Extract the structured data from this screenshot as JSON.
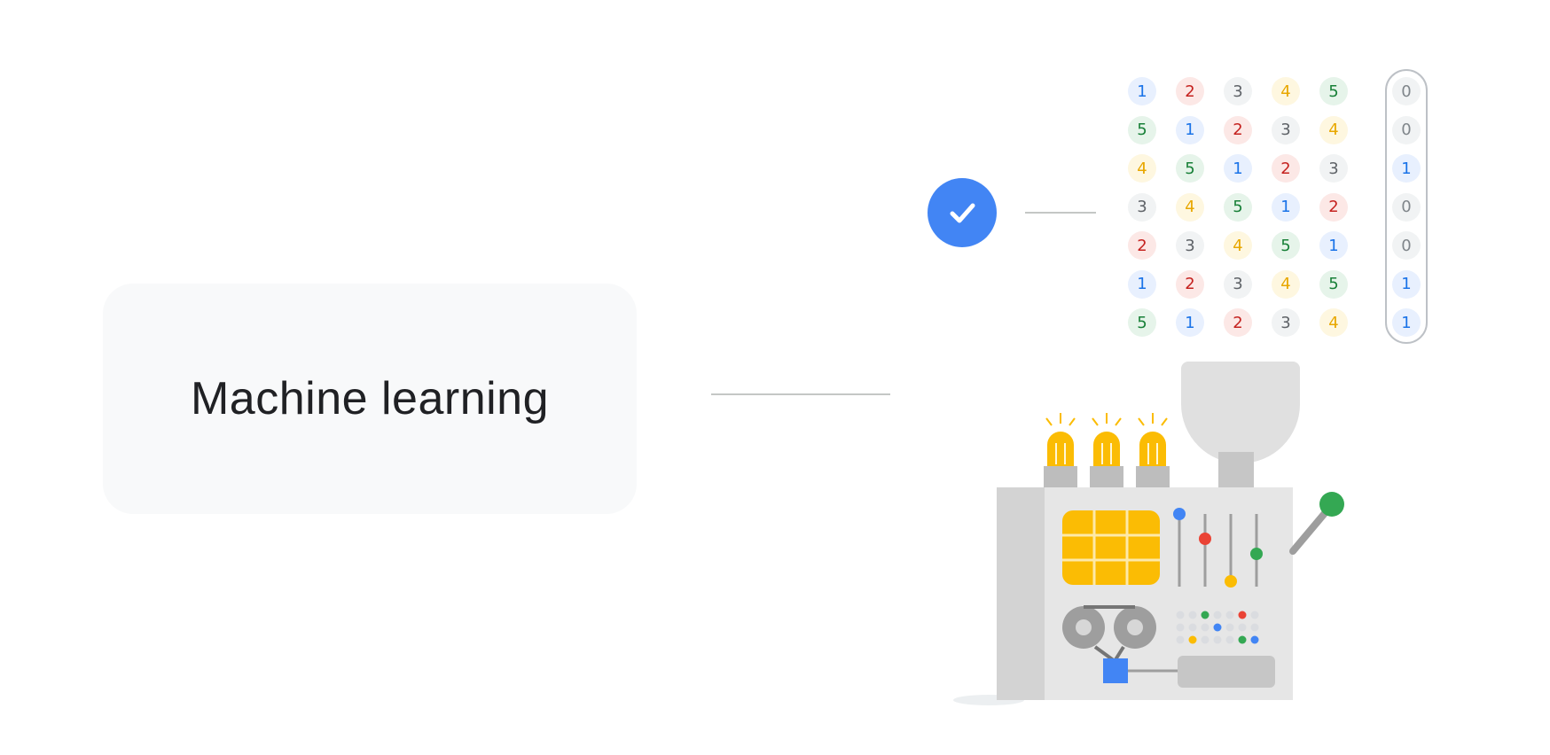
{
  "heading": "Machine learning",
  "colors": {
    "blue": "#4285f4",
    "red": "#ea4335",
    "yellow": "#fbbc04",
    "green": "#34a853",
    "gray": "#dadce0"
  },
  "icons": {
    "check": "check-icon",
    "machine": "ml-machine-illustration"
  },
  "data_grid": {
    "rows": [
      [
        1,
        2,
        3,
        4,
        5
      ],
      [
        5,
        1,
        2,
        3,
        4
      ],
      [
        4,
        5,
        1,
        2,
        3
      ],
      [
        3,
        4,
        5,
        1,
        2
      ],
      [
        2,
        3,
        4,
        5,
        1
      ],
      [
        1,
        2,
        3,
        4,
        5
      ],
      [
        5,
        1,
        2,
        3,
        4
      ]
    ],
    "labels": [
      0,
      0,
      1,
      0,
      0,
      1,
      1
    ]
  }
}
